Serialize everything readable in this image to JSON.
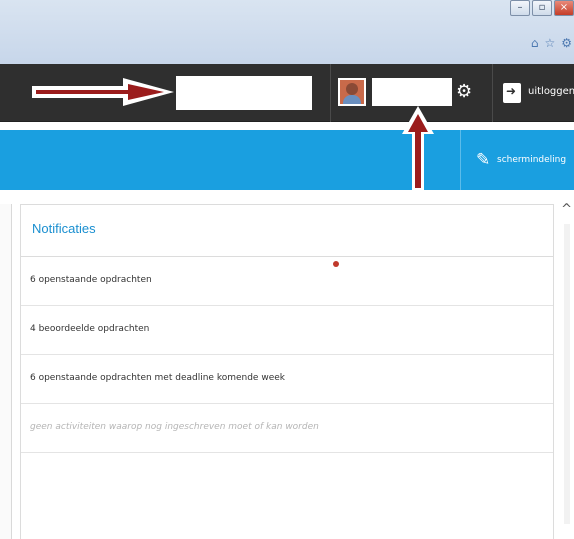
{
  "browser": {
    "window_buttons": [
      {
        "name": "minimize-button",
        "glyph": "–"
      },
      {
        "name": "restore-button",
        "glyph": "▫"
      },
      {
        "name": "close-button",
        "glyph": "×"
      }
    ],
    "toolbar_icons": [
      {
        "name": "home-icon",
        "glyph": "⌂"
      },
      {
        "name": "star-icon",
        "glyph": "☆"
      },
      {
        "name": "settings-icon",
        "glyph": "⚙"
      }
    ]
  },
  "header": {
    "gear_glyph": "⚙",
    "logout_label": "uitloggen"
  },
  "toolbar": {
    "pencil_glyph": "✎",
    "schedule_label": "schermindeling"
  },
  "notifications": {
    "title": "Notificaties",
    "items": [
      {
        "text": "6 openstaande opdrachten",
        "muted": false
      },
      {
        "text": "4 beoordeelde opdrachten",
        "muted": false
      },
      {
        "text": "6 openstaande opdrachten met deadline komende week",
        "muted": false
      },
      {
        "text": "geen activiteiten waarop nog ingeschreven moet of kan worden",
        "muted": true
      }
    ]
  },
  "scroll": {
    "up_glyph": "^"
  },
  "colors": {
    "header_bg": "#2f2f2f",
    "accent_blue": "#1a9fe0",
    "annotation_red": "#9b1c1c"
  }
}
